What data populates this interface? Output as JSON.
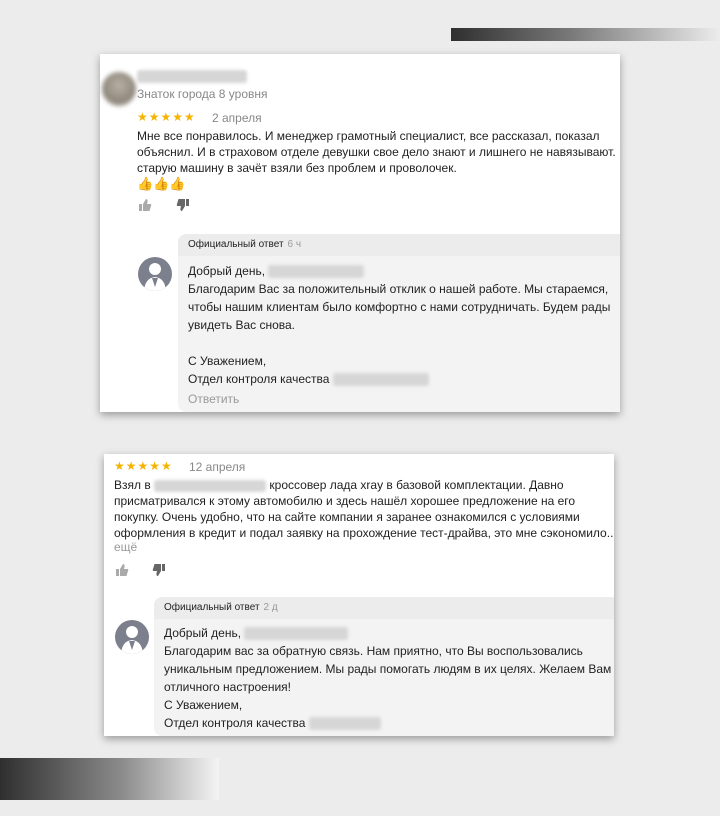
{
  "review1": {
    "author_level": "Знаток города 8 уровня",
    "rating": "★★★★★",
    "date": "2 апреля",
    "text_lines": [
      "Мне все понравилось. И менеджер грамотный специалист, все рассказал, показал",
      "объяснил. И в страховом отделе девушки свое дело знают и лишнего не навязывают. И",
      "старую машину в зачёт взяли без проблем и проволочек."
    ],
    "emoji": "👍👍👍",
    "like_icon": "thumb-up-icon",
    "dislike_icon": "thumb-down-icon",
    "reply": {
      "label": "Официальный ответ",
      "ago": "6 ч",
      "greeting": "Добрый день,",
      "lines": [
        "Благодарим Вас за положительный отклик о нашей работе. Мы стараемся,",
        "чтобы нашим клиентам было комфортно с нами сотрудничать. Будем рады",
        "увидеть Вас снова."
      ],
      "closing": "С Уважением,",
      "signature": "Отдел контроля качества",
      "answer_link": "Ответить"
    }
  },
  "review2": {
    "rating": "★★★★★",
    "date": "12 апреля",
    "text_start": "Взял в",
    "text_first_rest": "кроссовер лада xray в базовой комплектации. Давно",
    "text_lines": [
      "присматривался к этому автомобилю и здесь нашёл хорошее предложение на его",
      "покупку. Очень удобно, что на сайте компании я заранее ознакомился с условиями",
      "оформления в кредит и подал заявку на прохождение тест-драйва, это мне сэкономило..."
    ],
    "more_link": "ещё",
    "reply": {
      "label": "Официальный ответ",
      "ago": "2 д",
      "greeting": "Добрый день,",
      "lines": [
        "Благодарим вас за обратную связь. Нам приятно, что Вы воспользовались",
        "уникальным предложением. Мы рады помогать людям в их целях. Желаем Вам",
        "отличного настроения!"
      ],
      "closing": "С Уважением,",
      "signature": "Отдел контроля качества"
    }
  }
}
